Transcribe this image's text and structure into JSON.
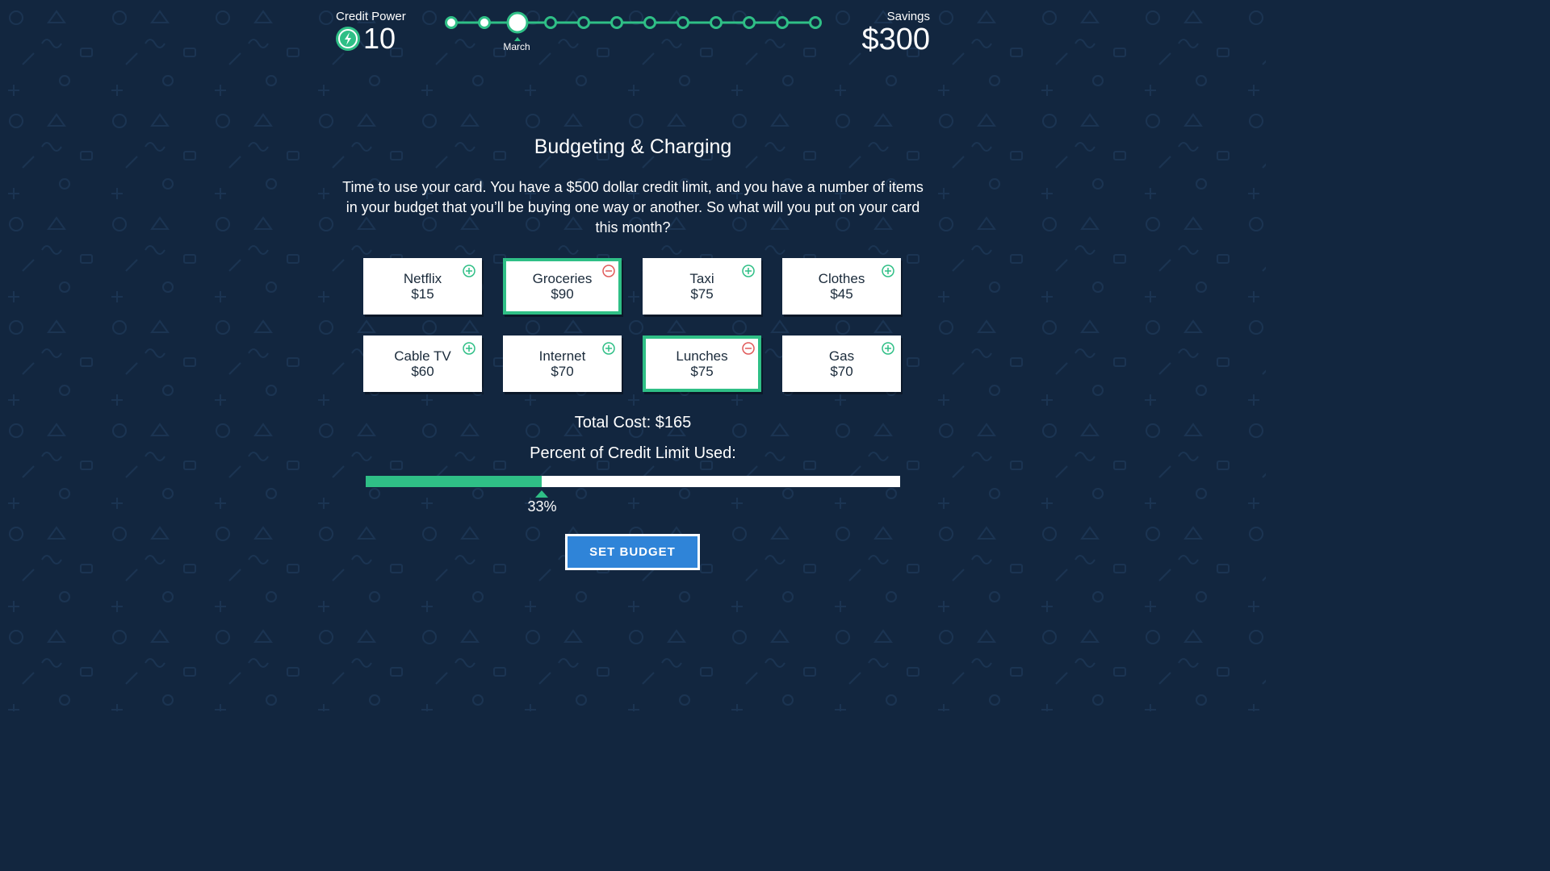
{
  "header": {
    "credit_label": "Credit Power",
    "credit_value": "10",
    "savings_label": "Savings",
    "savings_value": "$300"
  },
  "timeline": {
    "current_month": "March",
    "total_steps": 12,
    "current_index": 2,
    "completed_count": 2
  },
  "main": {
    "title": "Budgeting & Charging",
    "intro": "Time to use your card. You have a $500 dollar credit limit, and you have a number of items in your budget that you’ll be buying one way or another. So what will you put on your card this month?"
  },
  "items": [
    {
      "name": "Netflix",
      "price": "$15",
      "selected": false
    },
    {
      "name": "Groceries",
      "price": "$90",
      "selected": true
    },
    {
      "name": "Taxi",
      "price": "$75",
      "selected": false
    },
    {
      "name": "Clothes",
      "price": "$45",
      "selected": false
    },
    {
      "name": "Cable TV",
      "price": "$60",
      "selected": false
    },
    {
      "name": "Internet",
      "price": "$70",
      "selected": false
    },
    {
      "name": "Lunches",
      "price": "$75",
      "selected": true
    },
    {
      "name": "Gas",
      "price": "$70",
      "selected": false
    }
  ],
  "summary": {
    "total_cost": "Total Cost: $165",
    "percent_label": "Percent of Credit Limit Used:",
    "percent_value": 33,
    "percent_text": "33%"
  },
  "actions": {
    "set_budget_label": "SET BUDGET"
  },
  "colors": {
    "background": "#12263f",
    "accent": "#2fbf86",
    "remove": "#e05a5a",
    "button": "#2f84d8"
  },
  "icons": {
    "credit": "bolt-icon",
    "add": "plus-circle-icon",
    "remove": "minus-circle-icon"
  }
}
